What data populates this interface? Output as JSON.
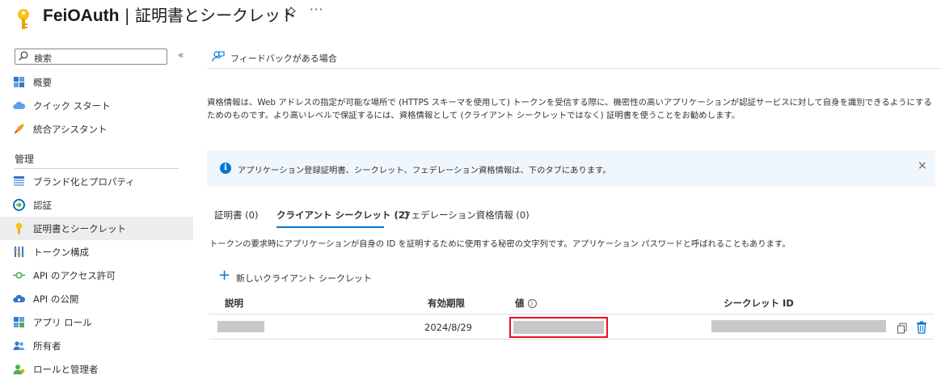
{
  "header": {
    "app_name": "FeiOAuth",
    "page_title": "| 証明書とシークレット",
    "pin_icon": "pin-icon",
    "more_label": "···"
  },
  "sidebar": {
    "search_placeholder": "検索",
    "collapse_label": "«",
    "items": [
      {
        "label": "概要",
        "icon": "overview-icon"
      },
      {
        "label": "クイック スタート",
        "icon": "cloud-quickstart-icon"
      },
      {
        "label": "統合アシスタント",
        "icon": "rocket-icon"
      }
    ],
    "section_label": "管理",
    "manage_items": [
      {
        "label": "ブランド化とプロパティ",
        "icon": "branding-icon"
      },
      {
        "label": "認証",
        "icon": "authentication-icon"
      },
      {
        "label": "証明書とシークレット",
        "icon": "key-icon",
        "active": true
      },
      {
        "label": "トークン構成",
        "icon": "token-config-icon"
      },
      {
        "label": "API のアクセス許可",
        "icon": "api-permissions-icon"
      },
      {
        "label": "API の公開",
        "icon": "expose-api-icon"
      },
      {
        "label": "アプリ ロール",
        "icon": "app-roles-icon"
      },
      {
        "label": "所有者",
        "icon": "owners-icon"
      },
      {
        "label": "ロールと管理者",
        "icon": "roles-admins-icon"
      }
    ]
  },
  "main": {
    "feedback_label": "フィードバックがある場合",
    "description": "資格情報は、Web アドレスの指定が可能な場所で (HTTPS スキーマを使用して) トークンを受信する際に、機密性の高いアプリケーションが認証サービスに対して自身を識別できるようにするためのものです。より高いレベルで保証するには、資格情報として (クライアント シークレットではなく) 証明書を使うことをお勧めします。",
    "banner_text": "アプリケーション登録証明書、シークレット、フェデレーション資格情報は、下のタブにあります。",
    "banner_close": "×",
    "tabs": [
      {
        "label": "証明書 (0)"
      },
      {
        "label": "クライアント シークレット (2)",
        "active": true
      },
      {
        "label": "フェデレーション資格情報 (0)"
      }
    ],
    "tab_description": "トークンの要求時にアプリケーションが自身の ID を証明するために使用する秘密の文字列です。アプリケーション パスワードと呼ばれることもあります。",
    "new_secret_plus": "+",
    "new_secret_label": "新しいクライアント シークレット",
    "table": {
      "headers": [
        "説明",
        "有効期限",
        "値",
        "シークレット ID"
      ],
      "rows": [
        {
          "expires": "2024/8/29"
        }
      ]
    }
  },
  "colors": {
    "accent": "#0078d4",
    "highlight_border": "#e81123",
    "banner_bg": "#eff6fc",
    "active_nav_bg": "#ededed"
  }
}
